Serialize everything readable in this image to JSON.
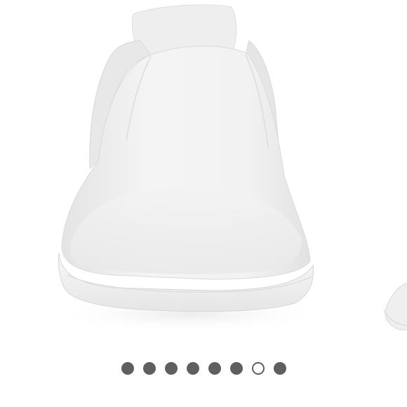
{
  "product": {
    "image_subject": "white-slip-on-shoe"
  },
  "carousel": {
    "total_slides": 8,
    "active_index": 6,
    "dot_color": "#5f5f5f",
    "active_dot_fill": "#ffffff"
  },
  "colors": {
    "background": "#ffffff",
    "shoe_body": "#f1f1f1",
    "shoe_shadow": "#dcdcdc",
    "sole": "#f7f7f7"
  }
}
